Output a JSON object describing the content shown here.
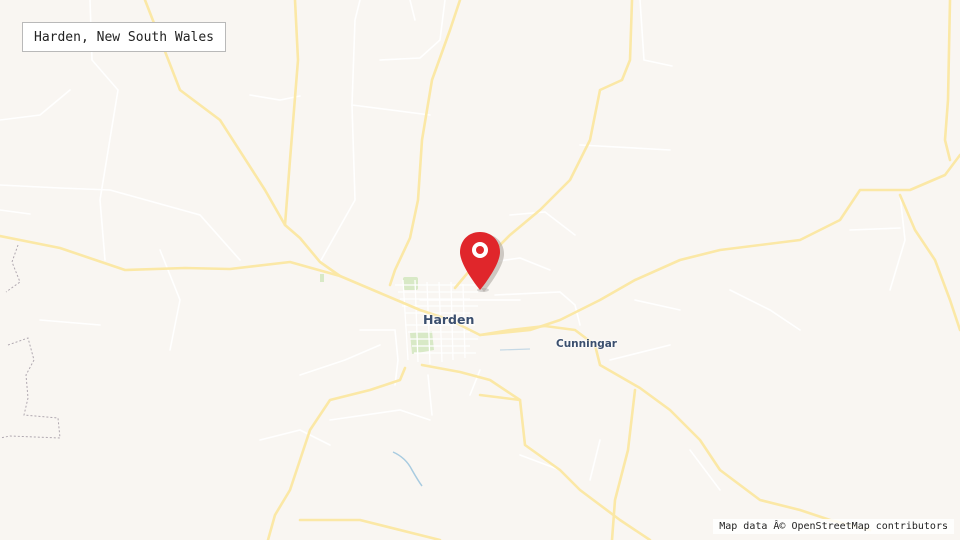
{
  "search": {
    "value": "Harden, New South Wales"
  },
  "map": {
    "places": {
      "town": "Harden",
      "village": "Cunningar"
    },
    "attribution": "Map data Â© OpenStreetMap contributors",
    "marker_icon": "map-pin-icon",
    "colors": {
      "background": "#f9f6f2",
      "major_road": "#fbe8a6",
      "minor_road": "#ffffff",
      "park": "#d8e9c6",
      "water": "#a8cbe0",
      "boundary": "#b0a8b0",
      "marker": "#e0262b",
      "label": "#3b4f6e"
    }
  }
}
